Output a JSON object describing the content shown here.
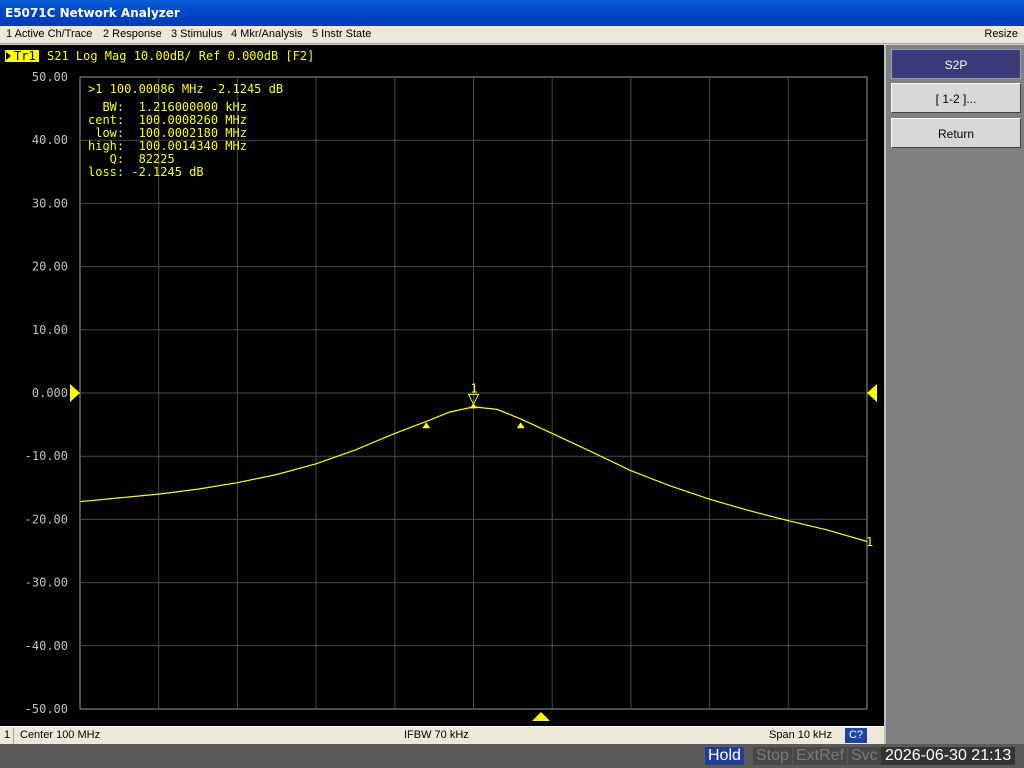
{
  "window": {
    "title": "E5071C Network Analyzer"
  },
  "menu": {
    "items": [
      "1 Active Ch/Trace",
      "2 Response",
      "3 Stimulus",
      "4 Mkr/Analysis",
      "5 Instr State"
    ],
    "resize": "Resize"
  },
  "trace": {
    "tr_tag": "Tr1",
    "header": "S21 Log Mag 10.00dB/ Ref 0.000dB [F2]",
    "trace_color": "#ffff00"
  },
  "marker": {
    "readout": ">1  100.00086 MHz -2.1245 dB",
    "label": "1",
    "end_label": "1",
    "stats": [
      "  BW:  1.216000000 kHz",
      "cent:  100.0008260 MHz",
      " low:  100.0002180 MHz",
      "high:  100.0014340 MHz",
      "   Q:  82225",
      "loss: -2.1245 dB"
    ]
  },
  "chart_data": {
    "type": "line",
    "title": "S21 Log Mag 10.00dB/ Ref 0.000dB [F2]",
    "ylim": [
      -50,
      50
    ],
    "xlim_khz": [
      -5,
      5
    ],
    "y_ticks": [
      "50.00",
      "40.00",
      "30.00",
      "20.00",
      "10.00",
      "0.000",
      "-10.00",
      "-20.00",
      "-30.00",
      "-40.00",
      "-50.00"
    ],
    "grid": true,
    "x_divisions": 10,
    "series": [
      {
        "name": "S21",
        "x_offset_khz": [
          -5,
          -4.5,
          -4,
          -3.5,
          -3,
          -2.5,
          -2,
          -1.5,
          -1,
          -0.6,
          -0.3,
          0,
          0.3,
          0.6,
          1,
          1.5,
          2,
          2.5,
          3,
          3.5,
          4,
          4.5,
          5
        ],
        "y_db": [
          -17.2,
          -16.6,
          -16.0,
          -15.2,
          -14.2,
          -12.9,
          -11.2,
          -9.0,
          -6.4,
          -4.5,
          -3.0,
          -2.2,
          -2.6,
          -4.1,
          -6.4,
          -9.3,
          -12.3,
          -14.7,
          -16.8,
          -18.6,
          -20.2,
          -21.7,
          -23.5
        ]
      }
    ],
    "markers": [
      {
        "label": "1",
        "x_offset_khz": 0,
        "y_db": -2.1245
      },
      {
        "label": "low",
        "x_offset_khz": -0.6,
        "y_db": -5.1
      },
      {
        "label": "high",
        "x_offset_khz": 0.6,
        "y_db": -5.1
      }
    ],
    "ref_level": 0.0
  },
  "bottom": {
    "channel": "1",
    "center": "Center 100 MHz",
    "ifbw": "IFBW 70 kHz",
    "span": "Span 10 kHz",
    "cal": "C?"
  },
  "softkeys": {
    "title": "S2P",
    "items": [
      "[ 1-2 ]...",
      "Return"
    ]
  },
  "status": {
    "hold": "Hold",
    "stop": "Stop",
    "extref": "ExtRef",
    "svc": "Svc",
    "datetime": "2026-06-30 21:13"
  }
}
